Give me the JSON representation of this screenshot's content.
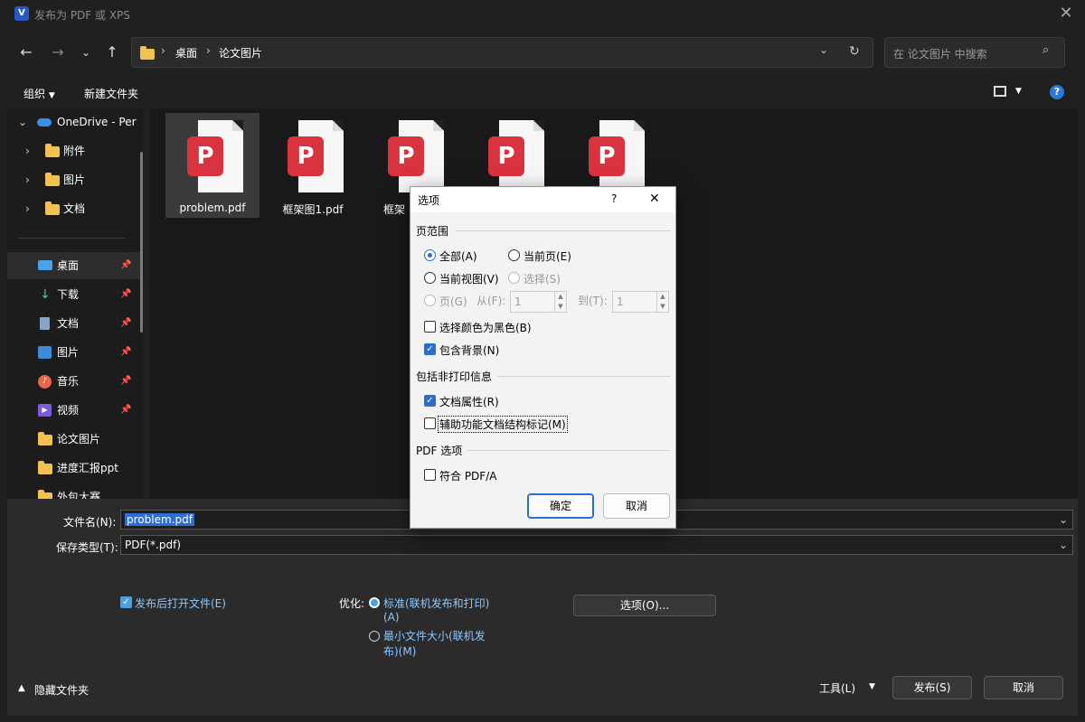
{
  "window": {
    "title": "发布为 PDF 或 XPS",
    "close_glyph": "✕"
  },
  "nav": {
    "breadcrumb": [
      "桌面",
      "论文图片"
    ],
    "search_placeholder": "在 论文图片 中搜索"
  },
  "toolbar": {
    "organize_label": "组织",
    "new_folder_label": "新建文件夹"
  },
  "sidebar": {
    "tree": [
      {
        "label": "OneDrive - Per",
        "icon": "cloud-icon"
      },
      {
        "label": "附件",
        "icon": "folder-icon"
      },
      {
        "label": "图片",
        "icon": "folder-icon"
      },
      {
        "label": "文档",
        "icon": "folder-icon"
      }
    ],
    "quick": [
      {
        "label": "桌面",
        "icon": "desktop-icon",
        "pinned": true
      },
      {
        "label": "下载",
        "icon": "download-icon",
        "pinned": true
      },
      {
        "label": "文档",
        "icon": "document-icon",
        "pinned": true
      },
      {
        "label": "图片",
        "icon": "pictures-icon",
        "pinned": true
      },
      {
        "label": "音乐",
        "icon": "music-icon",
        "pinned": true
      },
      {
        "label": "视频",
        "icon": "video-icon",
        "pinned": true
      },
      {
        "label": "论文图片",
        "icon": "folder-icon",
        "pinned": false
      },
      {
        "label": "进度汇报ppt",
        "icon": "folder-icon",
        "pinned": false
      },
      {
        "label": "外包大赛",
        "icon": "folder-icon",
        "pinned": false
      }
    ]
  },
  "files": [
    {
      "name": "problem.pdf",
      "selected": true
    },
    {
      "name": "框架图1.pdf",
      "selected": false
    },
    {
      "name": "框架",
      "selected": false
    },
    {
      "name": "",
      "selected": false
    },
    {
      "name": "",
      "selected": false
    }
  ],
  "bottom": {
    "filename_label": "文件名(N):",
    "filename_value": "problem.pdf",
    "savetype_label": "保存类型(T):",
    "savetype_value": "PDF(*.pdf)",
    "open_after_publish_label": "发布后打开文件(E)",
    "open_after_publish_checked": true,
    "optimize_label": "优化:",
    "optimize_standard_line1": "标准(联机发布和打印)",
    "optimize_standard_line2": "(A)",
    "optimize_min_line1": "最小文件大小(联机发",
    "optimize_min_line2": "布)(M)",
    "options_button": "选项(O)...",
    "hide_folders_label": "隐藏文件夹",
    "tools_label": "工具(L)",
    "publish_button": "发布(S)",
    "cancel_button": "取消"
  },
  "dialog": {
    "title": "选项",
    "help_glyph": "?",
    "close_glyph": "✕",
    "page_range_heading": "页范围",
    "radio_all": "全部(A)",
    "radio_current_page": "当前页(E)",
    "radio_current_view": "当前视图(V)",
    "radio_selection": "选择(S)",
    "radio_pages": "页(G)",
    "from_label": "从(F):",
    "from_value": "1",
    "to_label": "到(T):",
    "to_value": "1",
    "cb_black": "选择颜色为黑色(B)",
    "cb_black_checked": false,
    "cb_background": "包含背景(N)",
    "cb_background_checked": true,
    "nonprint_heading": "包括非打印信息",
    "cb_doc_props": "文档属性(R)",
    "cb_doc_props_checked": true,
    "cb_accessibility": "辅助功能文档结构标记(M)",
    "cb_accessibility_checked": false,
    "pdf_options_heading": "PDF 选项",
    "cb_pdfa": "符合 PDF/A",
    "cb_pdfa_checked": false,
    "ok_button": "确定",
    "cancel_button": "取消"
  }
}
